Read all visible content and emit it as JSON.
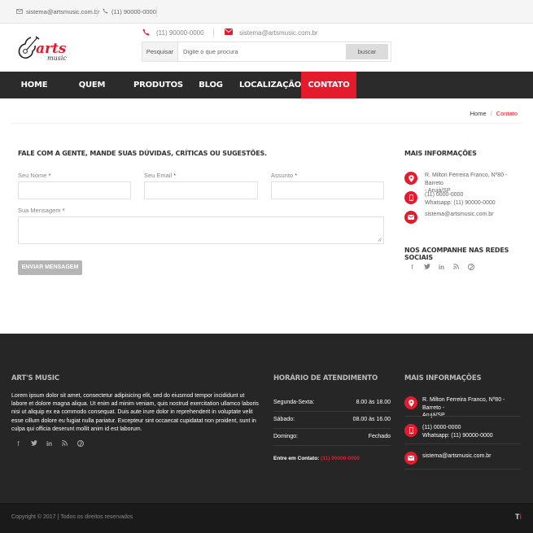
{
  "topbar": {
    "email": "sistema@artsmusic.com.br",
    "phone": "(11) 90000-0000"
  },
  "logo": {
    "text": "arts",
    "subtext": "music"
  },
  "header": {
    "phone": "(11) 90000-0000",
    "email": "sistema@artsmusic.com.br"
  },
  "search": {
    "label": "Pesquisar",
    "placeholder": "Digite o que procura",
    "button": "buscar"
  },
  "nav": {
    "items": [
      "HOME",
      "QUEM SOMOS",
      "PRODUTOS",
      "BLOG",
      "LOCALIZAÇÃO",
      "CONTATO"
    ],
    "active": "CONTATO"
  },
  "breadcrumb": {
    "home": "Home",
    "separator": "/",
    "current": "Contato"
  },
  "form": {
    "title": "FALE COM A GENTE, MANDE SUAS DÚVIDAS, CRÍTICAS OU SUGESTÕES.",
    "name_label": "Seu Nome",
    "email_label": "Seu Email",
    "subject_label": "Assunto",
    "message_label": "Sua Mensagem",
    "required_mark": "*",
    "submit": "ENVIAR MENSAGEM"
  },
  "sidebar": {
    "info_title": "MAIS INFORMAÇÕES",
    "address_line1": "R. Milton Ferreira Franco, Nº80 - Barreto",
    "address_line2": "- Arujá/SP",
    "phone_line1": "(11) 0000-0000",
    "phone_line2": "Whatsapp: (11) 90000-0000",
    "email": "sistema@artsmusic.com.br",
    "social_title": "NOS ACOMPANHE NAS REDES SOCIAIS"
  },
  "footer": {
    "about_title": "ART'S MUSIC",
    "about_text": "Lorem ipsum dolor sit amet, consectetur adipisicing elit, sed do eiusmod tempor incididunt ut labore et dolore magna aliqua. Ut enim ad minim veniam, quis nostrud exercitation ullamco laboris nisi ut aliquip ex ea commodo consequat. Duis aute irure dolor in reprehenderit in voluptate velit esse cillum dolore eu fugiat nulla pariatur. Excepteur sint occaecat cupidatat non proident, sunt in culpa qui officia deserunt mollit anim id est laborum.",
    "hours_title": "HORÁRIO DE ATENDIMENTO",
    "hours": [
      {
        "day": "Segunda-Sexta:",
        "time": "8.00 às 18.00"
      },
      {
        "day": "Sábado:",
        "time": "08.00 às 16.00"
      },
      {
        "day": "Domingo:",
        "time": "Fechado"
      }
    ],
    "contact_label": "Entre em Contato:",
    "contact_phone": "(11) 90000-0000",
    "info_title": "MAIS INFORMAÇÕES",
    "address_line1": "R. Milton Ferreira Franco, Nº80 - Barreto -",
    "address_line2": "Arujá/SP",
    "phone_line1": "(11) 0000-0000",
    "phone_line2": "Whatsapp: (11) 90000-0000",
    "email": "sistema@artsmusic.com.br"
  },
  "copyright": {
    "text": "Copyright © 2017 | Todos os direitos reservados",
    "mark_t": "T",
    "mark_i": "i"
  },
  "icons": {
    "email": "envelope-icon",
    "phone": "phone-icon",
    "address": "map-pin-icon",
    "mobile": "mobile-icon",
    "social": [
      "facebook-icon",
      "twitter-icon",
      "linkedin-icon",
      "rss-icon",
      "pinterest-icon"
    ]
  },
  "colors": {
    "accent": "#e41b2d",
    "nav_bg": "#2b2b2b",
    "footer_bg": "#262626",
    "copyright_bg": "#1a1a1a"
  }
}
